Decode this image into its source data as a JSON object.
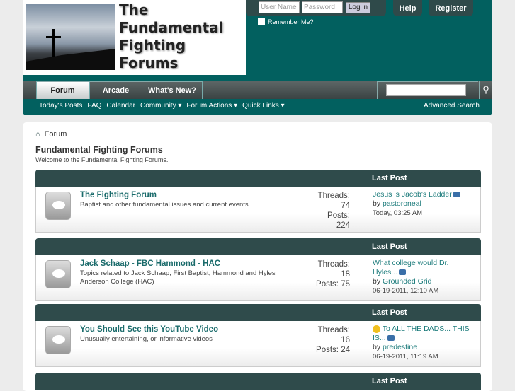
{
  "logo": {
    "lines": [
      "The",
      "Fundamental",
      "Fighting",
      "Forums"
    ]
  },
  "login": {
    "username_placeholder": "User Name",
    "password_placeholder": "Password",
    "login_label": "Log in",
    "remember_label": "Remember Me?"
  },
  "top_buttons": {
    "help": "Help",
    "register": "Register"
  },
  "nav": {
    "tabs": [
      "Forum",
      "Arcade",
      "What's New?"
    ],
    "sub": [
      "Today's Posts",
      "FAQ",
      "Calendar",
      "Community ▾",
      "Forum Actions ▾",
      "Quick Links ▾"
    ],
    "advanced_search": "Advanced Search"
  },
  "breadcrumb": "Forum",
  "page": {
    "title": "Fundamental Fighting Forums",
    "welcome": "Welcome to the Fundamental Fighting Forums."
  },
  "last_post_header": "Last Post",
  "forums": [
    {
      "name": "The Fighting Forum",
      "desc": "Baptist and other fundamental issues and current events",
      "stats": [
        "Threads:",
        "74",
        "Posts:",
        "224"
      ],
      "last_title": "Jesus is Jacob's Ladder",
      "by": "by",
      "user": "pastoroneal",
      "date": "Today, 03:25 AM"
    },
    {
      "name": "Jack Schaap - FBC Hammond - HAC",
      "desc": "Topics related to Jack Schaap, First Baptist, Hammond and Hyles Anderson College (HAC)",
      "stats": [
        "Threads:",
        "18",
        "Posts: 75"
      ],
      "last_title": "What college would Dr. Hyles...",
      "by": "by",
      "user": "Grounded Grid",
      "date": "06-19-2011, 12:10 AM"
    },
    {
      "name": "You Should See this YouTube Video",
      "desc": "Unusually entertaining, or informative videos",
      "stats": [
        "Threads:",
        "16",
        "Posts: 24"
      ],
      "last_title": "To ALL THE DADS... THIS IS...",
      "by": "by",
      "user": "predestine",
      "date": "06-19-2011, 11:19 AM"
    }
  ]
}
